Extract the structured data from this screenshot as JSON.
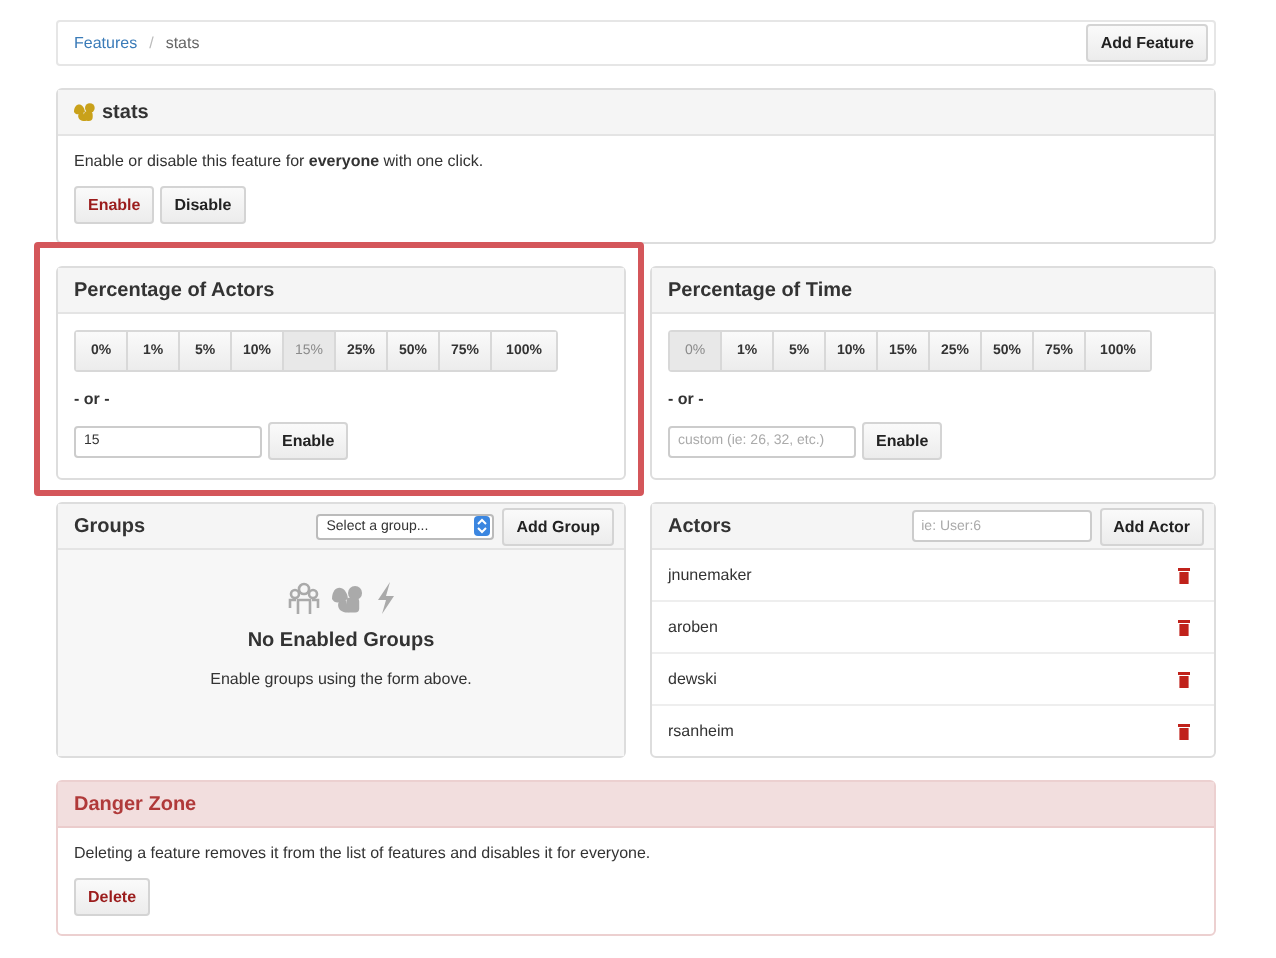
{
  "breadcrumb": {
    "link": "Features",
    "separator": "/",
    "current": "stats",
    "button": "Add Feature"
  },
  "feature": {
    "title": "stats",
    "description": "Enable or disable this feature for **everyone** with one click.",
    "buttons": [
      {
        "label": "Enable",
        "kind": "danger"
      },
      {
        "label": "Disable",
        "kind": "plain"
      }
    ]
  },
  "percentage_panels": [
    {
      "title": "Percentage of Actors",
      "highlighted": true,
      "options": [
        {
          "label": "0%",
          "selected": false
        },
        {
          "label": "1%",
          "selected": false
        },
        {
          "label": "5%",
          "selected": false
        },
        {
          "label": "10%",
          "selected": false
        },
        {
          "label": "15%",
          "selected": true
        },
        {
          "label": "25%",
          "selected": false
        },
        {
          "label": "50%",
          "selected": false
        },
        {
          "label": "75%",
          "selected": false
        },
        {
          "label": "100%",
          "selected": false
        }
      ],
      "or_label": "- or -",
      "input": {
        "value": "15"
      },
      "button": "Enable"
    },
    {
      "title": "Percentage of Time",
      "options": [
        {
          "label": "0%",
          "selected": true
        },
        {
          "label": "1%",
          "selected": false
        },
        {
          "label": "5%",
          "selected": false
        },
        {
          "label": "10%",
          "selected": false
        },
        {
          "label": "15%",
          "selected": false
        },
        {
          "label": "25%",
          "selected": false
        },
        {
          "label": "50%",
          "selected": false
        },
        {
          "label": "75%",
          "selected": false
        },
        {
          "label": "100%",
          "selected": false
        }
      ],
      "or_label": "- or -",
      "input": {
        "placeholder": "custom (ie: 26, 32, etc.)"
      },
      "button": "Enable"
    }
  ],
  "groups": {
    "title": "Groups",
    "select": "Select a group...",
    "button": "Add Group",
    "empty_title": "No Enabled Groups",
    "empty_text": "Enable groups using the form above."
  },
  "actors": {
    "title": "Actors",
    "input": {
      "placeholder": "ie: User:6"
    },
    "button": "Add Actor",
    "items": [
      "jnunemaker",
      "aroben",
      "dewski",
      "rsanheim"
    ]
  },
  "danger_zone": {
    "title": "Danger Zone",
    "text": "Deleting a feature removes it from the list of features and disables it for everyone.",
    "button": "Delete"
  }
}
